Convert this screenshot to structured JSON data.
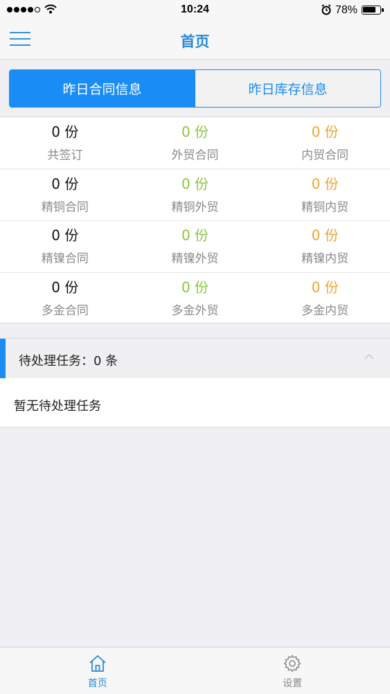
{
  "status_bar": {
    "time": "10:24",
    "battery_percent": "78%",
    "battery_level": 0.78,
    "signal_bars": 4,
    "signal_total": 5
  },
  "nav": {
    "title": "首页"
  },
  "segments": {
    "active": "昨日合同信息",
    "inactive": "昨日库存信息"
  },
  "stats": [
    [
      {
        "value": "0 份",
        "label": "共签订",
        "color": "black"
      },
      {
        "value": "0 份",
        "label": "外贸合同",
        "color": "green"
      },
      {
        "value": "0 份",
        "label": "内贸合同",
        "color": "orange"
      }
    ],
    [
      {
        "value": "0 份",
        "label": "精铜合同",
        "color": "black"
      },
      {
        "value": "0 份",
        "label": "精铜外贸",
        "color": "green"
      },
      {
        "value": "0 份",
        "label": "精铜内贸",
        "color": "orange"
      }
    ],
    [
      {
        "value": "0 份",
        "label": "精镍合同",
        "color": "black"
      },
      {
        "value": "0 份",
        "label": "精镍外贸",
        "color": "green"
      },
      {
        "value": "0 份",
        "label": "精镍内贸",
        "color": "orange"
      }
    ],
    [
      {
        "value": "0 份",
        "label": "多金合同",
        "color": "black"
      },
      {
        "value": "0 份",
        "label": "多金外贸",
        "color": "green"
      },
      {
        "value": "0 份",
        "label": "多金内贸",
        "color": "orange"
      }
    ]
  ],
  "tasks": {
    "header": "待处理任务：0 条",
    "empty_text": "暂无待处理任务"
  },
  "tab_bar": {
    "items": [
      {
        "label": "首页",
        "icon": "home-icon",
        "active": true
      },
      {
        "label": "设置",
        "icon": "gear-icon",
        "active": false
      }
    ]
  },
  "colors": {
    "accent": "#1a8cf5",
    "title_blue": "#2b88d8",
    "green": "#8cc63f",
    "orange": "#f0a630"
  }
}
